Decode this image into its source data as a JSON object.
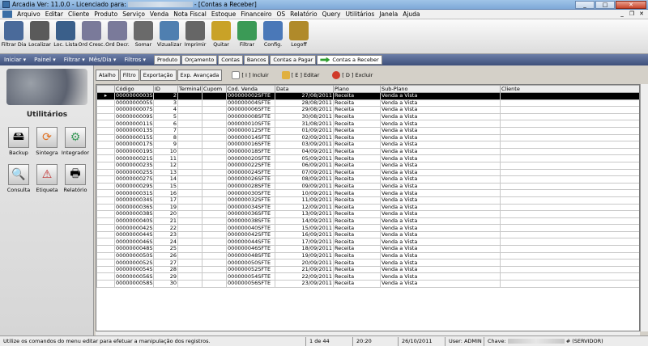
{
  "titlebar": {
    "app": "Arcadia Ver: 11.0.0 - Licenciado para:",
    "window": "- [Contas a Receber]"
  },
  "menu": [
    "Arquivo",
    "Editar",
    "Cliente",
    "Produto",
    "Serviço",
    "Venda",
    "Nota Fiscal",
    "Estoque",
    "Financeiro",
    "OS",
    "Relatório",
    "Query",
    "Utilitários",
    "Janela",
    "Ajuda"
  ],
  "toolbar": [
    {
      "label": "Filtrar Dia",
      "icon": "calendar-icon",
      "color": "#4a6a9a"
    },
    {
      "label": "Localizar",
      "icon": "binoculars-icon",
      "color": "#5a5a5a"
    },
    {
      "label": "Loc. Lista",
      "icon": "search-list-icon",
      "color": "#3a5f8a"
    },
    {
      "label": "Ord Cresc.",
      "icon": "sort-ascending-icon",
      "color": "#7a7a9a"
    },
    {
      "label": "Ord Decr.",
      "icon": "sort-descending-icon",
      "color": "#7a7a9a"
    },
    {
      "label": "Somar",
      "icon": "calculator-icon",
      "color": "#6a6a6a"
    },
    {
      "label": "Vizualizar",
      "icon": "magnifier-icon",
      "color": "#4f7fb0"
    },
    {
      "label": "Imprimir",
      "icon": "printer-icon",
      "color": "#666666"
    },
    {
      "label": "Quitar",
      "icon": "money-icon",
      "color": "#c9a227"
    },
    {
      "label": "Filtrar",
      "icon": "filter-icon",
      "color": "#3b9a56"
    },
    {
      "label": "Config.",
      "icon": "gear-icon",
      "color": "#4a78b8"
    },
    {
      "label": "Logoff",
      "icon": "lock-icon",
      "color": "#b08a2a"
    }
  ],
  "nav": [
    "Iniciar",
    "Painel",
    "Filtrar",
    "Mês/Dia",
    "Filtros"
  ],
  "navtabs": [
    "Produto",
    "Orçamento",
    "Contas",
    "Bancos",
    "Contas a Pagar",
    "Contas a Receber"
  ],
  "left": {
    "title": "Utilitários",
    "buttons": [
      "Backup",
      "Sintegra",
      "Integrador",
      "Consulta",
      "Etiqueta",
      "Relatório"
    ]
  },
  "actions": {
    "atalho": "Atalho",
    "filtro": "Filtro",
    "exportacao": "Exportação",
    "exp_avancada": "Exp. Avançada",
    "incluir": "[ I ] Incluir",
    "editar": "[ E ] Editar",
    "excluir": "[ D ] Excluir"
  },
  "grid": {
    "headers": [
      "Código",
      "ID",
      "Terminal",
      "Cupom",
      "Cod. Venda",
      "Data",
      "Plano",
      "Sub-Plano",
      "Cliente"
    ],
    "rows": [
      [
        "0000000003S",
        "2",
        "",
        "",
        "000000002SFTE",
        "27/08/2011",
        "Receita",
        "Venda a Vista",
        ""
      ],
      [
        "0000000005S",
        "3",
        "",
        "",
        "000000004SFTE",
        "28/08/2011",
        "Receita",
        "Venda a Vista",
        ""
      ],
      [
        "0000000007S",
        "4",
        "",
        "",
        "000000006SFTE",
        "29/08/2011",
        "Receita",
        "Venda a Vista",
        ""
      ],
      [
        "0000000009S",
        "5",
        "",
        "",
        "000000008SFTE",
        "30/08/2011",
        "Receita",
        "Venda a Vista",
        ""
      ],
      [
        "0000000011S",
        "6",
        "",
        "",
        "000000010SFTE",
        "31/08/2011",
        "Receita",
        "Venda a Vista",
        ""
      ],
      [
        "0000000013S",
        "7",
        "",
        "",
        "000000012SFTE",
        "01/09/2011",
        "Receita",
        "Venda a Vista",
        ""
      ],
      [
        "0000000015S",
        "8",
        "",
        "",
        "000000014SFTE",
        "02/09/2011",
        "Receita",
        "Venda a Vista",
        ""
      ],
      [
        "0000000017S",
        "9",
        "",
        "",
        "000000016SFTE",
        "03/09/2011",
        "Receita",
        "Venda a Vista",
        ""
      ],
      [
        "0000000019S",
        "10",
        "",
        "",
        "000000018SFTE",
        "04/09/2011",
        "Receita",
        "Venda a Vista",
        ""
      ],
      [
        "0000000021S",
        "11",
        "",
        "",
        "000000020SFTE",
        "05/09/2011",
        "Receita",
        "Venda a Vista",
        ""
      ],
      [
        "0000000023S",
        "12",
        "",
        "",
        "000000022SFTE",
        "06/09/2011",
        "Receita",
        "Venda a Vista",
        ""
      ],
      [
        "0000000025S",
        "13",
        "",
        "",
        "000000024SFTE",
        "07/09/2011",
        "Receita",
        "Venda a Vista",
        ""
      ],
      [
        "0000000027S",
        "14",
        "",
        "",
        "000000026SFTE",
        "08/09/2011",
        "Receita",
        "Venda a Vista",
        ""
      ],
      [
        "0000000029S",
        "15",
        "",
        "",
        "000000028SFTE",
        "09/09/2011",
        "Receita",
        "Venda a Vista",
        ""
      ],
      [
        "0000000031S",
        "16",
        "",
        "",
        "000000030SFTE",
        "10/09/2011",
        "Receita",
        "Venda a Vista",
        ""
      ],
      [
        "0000000034S",
        "17",
        "",
        "",
        "000000032SFTE",
        "11/09/2011",
        "Receita",
        "Venda a Vista",
        ""
      ],
      [
        "0000000036S",
        "19",
        "",
        "",
        "000000034SFTE",
        "12/09/2011",
        "Receita",
        "Venda a Vista",
        ""
      ],
      [
        "0000000038S",
        "20",
        "",
        "",
        "000000036SFTE",
        "13/09/2011",
        "Receita",
        "Venda a Vista",
        ""
      ],
      [
        "0000000040S",
        "21",
        "",
        "",
        "000000038SFTE",
        "14/09/2011",
        "Receita",
        "Venda a Vista",
        ""
      ],
      [
        "0000000042S",
        "22",
        "",
        "",
        "000000040SFTE",
        "15/09/2011",
        "Receita",
        "Venda a Vista",
        ""
      ],
      [
        "0000000044S",
        "23",
        "",
        "",
        "000000042SFTE",
        "16/09/2011",
        "Receita",
        "Venda a Vista",
        ""
      ],
      [
        "0000000046S",
        "24",
        "",
        "",
        "000000044SFTE",
        "17/09/2011",
        "Receita",
        "Venda a Vista",
        ""
      ],
      [
        "0000000048S",
        "25",
        "",
        "",
        "000000046SFTE",
        "18/09/2011",
        "Receita",
        "Venda a Vista",
        ""
      ],
      [
        "0000000050S",
        "26",
        "",
        "",
        "000000048SFTE",
        "19/09/2011",
        "Receita",
        "Venda a Vista",
        ""
      ],
      [
        "0000000052S",
        "27",
        "",
        "",
        "000000050SFTE",
        "20/09/2011",
        "Receita",
        "Venda a Vista",
        ""
      ],
      [
        "0000000054S",
        "28",
        "",
        "",
        "000000052SFTE",
        "21/09/2011",
        "Receita",
        "Venda a Vista",
        ""
      ],
      [
        "0000000056S",
        "29",
        "",
        "",
        "000000054SFTE",
        "22/09/2011",
        "Receita",
        "Venda a Vista",
        ""
      ],
      [
        "0000000058S",
        "30",
        "",
        "",
        "000000056SFTE",
        "23/09/2011",
        "Receita",
        "Venda a Vista",
        ""
      ]
    ]
  },
  "status": {
    "message": "Utilize os comandos do menu editar para efetuar a manipulação dos registros.",
    "position": "1 de 44",
    "time": "20:20",
    "date": "26/10/2011",
    "user": "User: ADMIN",
    "key_label": "Chave:",
    "server": "# (SERVIDOR)"
  }
}
